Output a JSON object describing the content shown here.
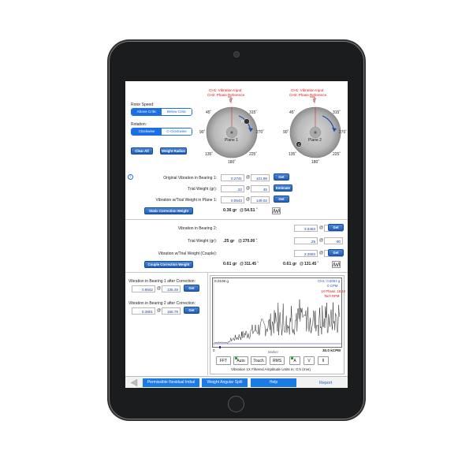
{
  "plane_labels": {
    "p1_ch1": "CH1: Vibration Input",
    "p1_ch2": "CH2: Phase Reference",
    "p2_ch1": "CH1: Vibration Input",
    "p2_ch2": "CH2: Phase Reference"
  },
  "rotor": {
    "speed_label": "Rotor Speed:",
    "speed_options": [
      "Above Critic",
      "Below Critic"
    ],
    "rotation_label": "Rotation:",
    "rotation_options": [
      "Clockwise",
      "C-Clockwise"
    ],
    "clear_all": "Clear All",
    "weight_radius": "Weight Radius"
  },
  "wheel1": {
    "name": "Plane 1",
    "marker": "C",
    "deg": {
      "d0": "0˚",
      "d45": "45˚",
      "d90": "90˚",
      "d135": "135˚",
      "d180": "180˚",
      "d225": "225˚",
      "d270": "270˚",
      "d315": "315˚"
    }
  },
  "wheel2": {
    "name": "Plane 2",
    "marker": "C",
    "deg": {
      "d0": "0˚",
      "d45": "45˚",
      "d90": "90˚",
      "d135": "135˚",
      "d180": "180˚",
      "d225": "225˚",
      "d270": "270˚",
      "d315": "315˚"
    }
  },
  "static": {
    "info_icon": "i",
    "orig_label": "Original Vibration in Bearing 1:",
    "orig_amp": "0.2741",
    "orig_phase": "101.98",
    "trial_label": "Trial Weight (gr):",
    "trial_amp": ".32",
    "trial_phase": "45",
    "vib_trial_label": "Vibration w/Trial Weight in Plane 1:",
    "vib_trial_amp": "0.0543",
    "vib_trial_phase": "149.02",
    "get": "Get",
    "estimate": "Estimate",
    "correction_btn": "Static Correction Weight",
    "result_wt": "0.36 gr",
    "result_at": "@",
    "result_deg": "54.51 ˚"
  },
  "couple": {
    "b2_label": "Vibration in Bearing 2:",
    "b2_amp": "3.0463",
    "b2_phase": "358.52",
    "trial_label": "Trial Weight (gr):",
    "trial_wt": ".25 gr",
    "trial_at": "@",
    "trial_deg": "270.00 ˚",
    "trial_amp": ".25",
    "trial_phase": "90",
    "vib_label": "Vibration w/Trial Weight (Couple):",
    "vib_amp": "2.2653",
    "vib_phase": "19.97",
    "get": "Get",
    "correction_btn": "Couple Correction Weight",
    "res1_wt": "0.61 gr",
    "res1_at": "@",
    "res1_deg": "311.45 ˚",
    "res2_wt": "0.61 gr",
    "res2_at": "@",
    "res2_deg": "131.45 ˚"
  },
  "after": {
    "b1_label": "Vibration in Bearing 1 after Correction:",
    "b1_amp": "0.9542",
    "b1_phase": "135.49",
    "b2_label": "Vibration in Bearing 2 after Correction:",
    "b2_amp": "0.3801",
    "b2_phase": "165.78",
    "get": "Get"
  },
  "spectrum": {
    "top_left": "0.0106 g",
    "ch1": "CH1: 0.0004 g",
    "cpm": "0 CPM",
    "phase": "1X Phase: 18.19",
    "tach": "Tach RPM: ",
    "x_start": "0",
    "marker": "Marker",
    "x_end": "30.0 kCPM",
    "caption": "Vibration 1X Filtered Amplitude Units in: G's (rms)",
    "buttons": [
      "FFT",
      "Auto",
      "Touch",
      "RMS",
      "A",
      "V",
      "II"
    ]
  },
  "bottom": {
    "permissible": "Permissible Residual Imbal",
    "split": "Weight Angular Split",
    "help": "Help",
    "report": "Report"
  },
  "colors": {
    "accent": "#1a6ee6",
    "button": "#1f5fb8",
    "alert": "#d11111",
    "bezel": "#1b1c1e"
  }
}
